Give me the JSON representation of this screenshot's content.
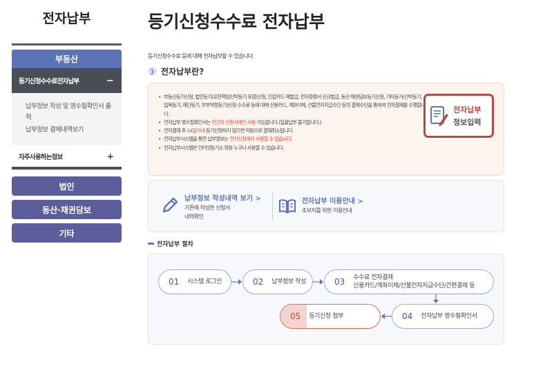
{
  "sidebar": {
    "title": "전자납부",
    "category_main": "부동산",
    "sub_active": "등기신청수수료전자납부",
    "sub_active_toggle": "−",
    "sub_links": [
      "납부정보 작성 및 영수필확인서 출력",
      "납부정보 결제내역보기"
    ],
    "sub_row2": "자주사용하는정보",
    "sub_row2_toggle": "+",
    "categories": [
      "법인",
      "동산·채권담보",
      "기타"
    ]
  },
  "main": {
    "title": "등기신청수수료 전자납부",
    "intro": "등기신청수수료 등에 대해 전자납부할 수 있습니다.",
    "section_title": "전자납부란?",
    "notice": {
      "items": [
        {
          "pre": "부동산등기신청, 법인등기(유한책임신탁등기 포함)신청, 인감카드 재발급, 전자증명서 신규발급, 동산·채권담보등기신청, 기타등기(선박등기, 입목등기, 재단등기, 부부약정등기)신청 수수료 등에 대해 신용카드, 계좌이체, 선불전자지급수단 등의 결제수단을 통하여 전자결제를 수행합니다.",
          "red": "",
          "post": ""
        },
        {
          "pre": "전자납부 영수필확인서는 ",
          "red": "한건의 신청서에만 사용",
          "post": " 가능합니다.(일괄납부 불가합니다.)"
        },
        {
          "pre": "전자결제 후 ",
          "red": "14일이내",
          "post": " 등기신청하지 않으면 자동으로 결제취소됩니다."
        },
        {
          "pre": "전자납부시스템을 통한 납부정보는 ",
          "red": "전자신청에서 사용할 수 있습니다.",
          "post": ""
        },
        {
          "pre": "전자납부시스템은 인터넷등기소 회원 누구나 사용할 수 있습니다.",
          "red": "",
          "post": ""
        }
      ],
      "entry_button": {
        "line1": "전자납부",
        "line2": "정보입력"
      }
    },
    "links": [
      {
        "title": "납부정보 작성내역 보기 >",
        "desc1": "기존에 작성한 신청서",
        "desc2": "내역확인"
      },
      {
        "title": "전자납부 이용안내 >",
        "desc1": "초보자를 위한 이용안내",
        "desc2": ""
      }
    ],
    "process_title": "전자납부 절차",
    "steps": [
      {
        "num": "01",
        "label": "시스템 로그인",
        "label2": ""
      },
      {
        "num": "02",
        "label": "납부정보 작성",
        "label2": ""
      },
      {
        "num": "03",
        "label": "수수료 전자결제",
        "label2": "신용카드/계좌이체/선불전자지급수단/간편결제 등"
      },
      {
        "num": "04",
        "label": "전자납부 영수필확인서",
        "label2": ""
      },
      {
        "num": "05",
        "label": "등기신청 첨부",
        "label2": ""
      }
    ]
  },
  "colors": {
    "accent": "#5d74b4",
    "highlight": "#d26a5e",
    "dark": "#4a4c56"
  }
}
